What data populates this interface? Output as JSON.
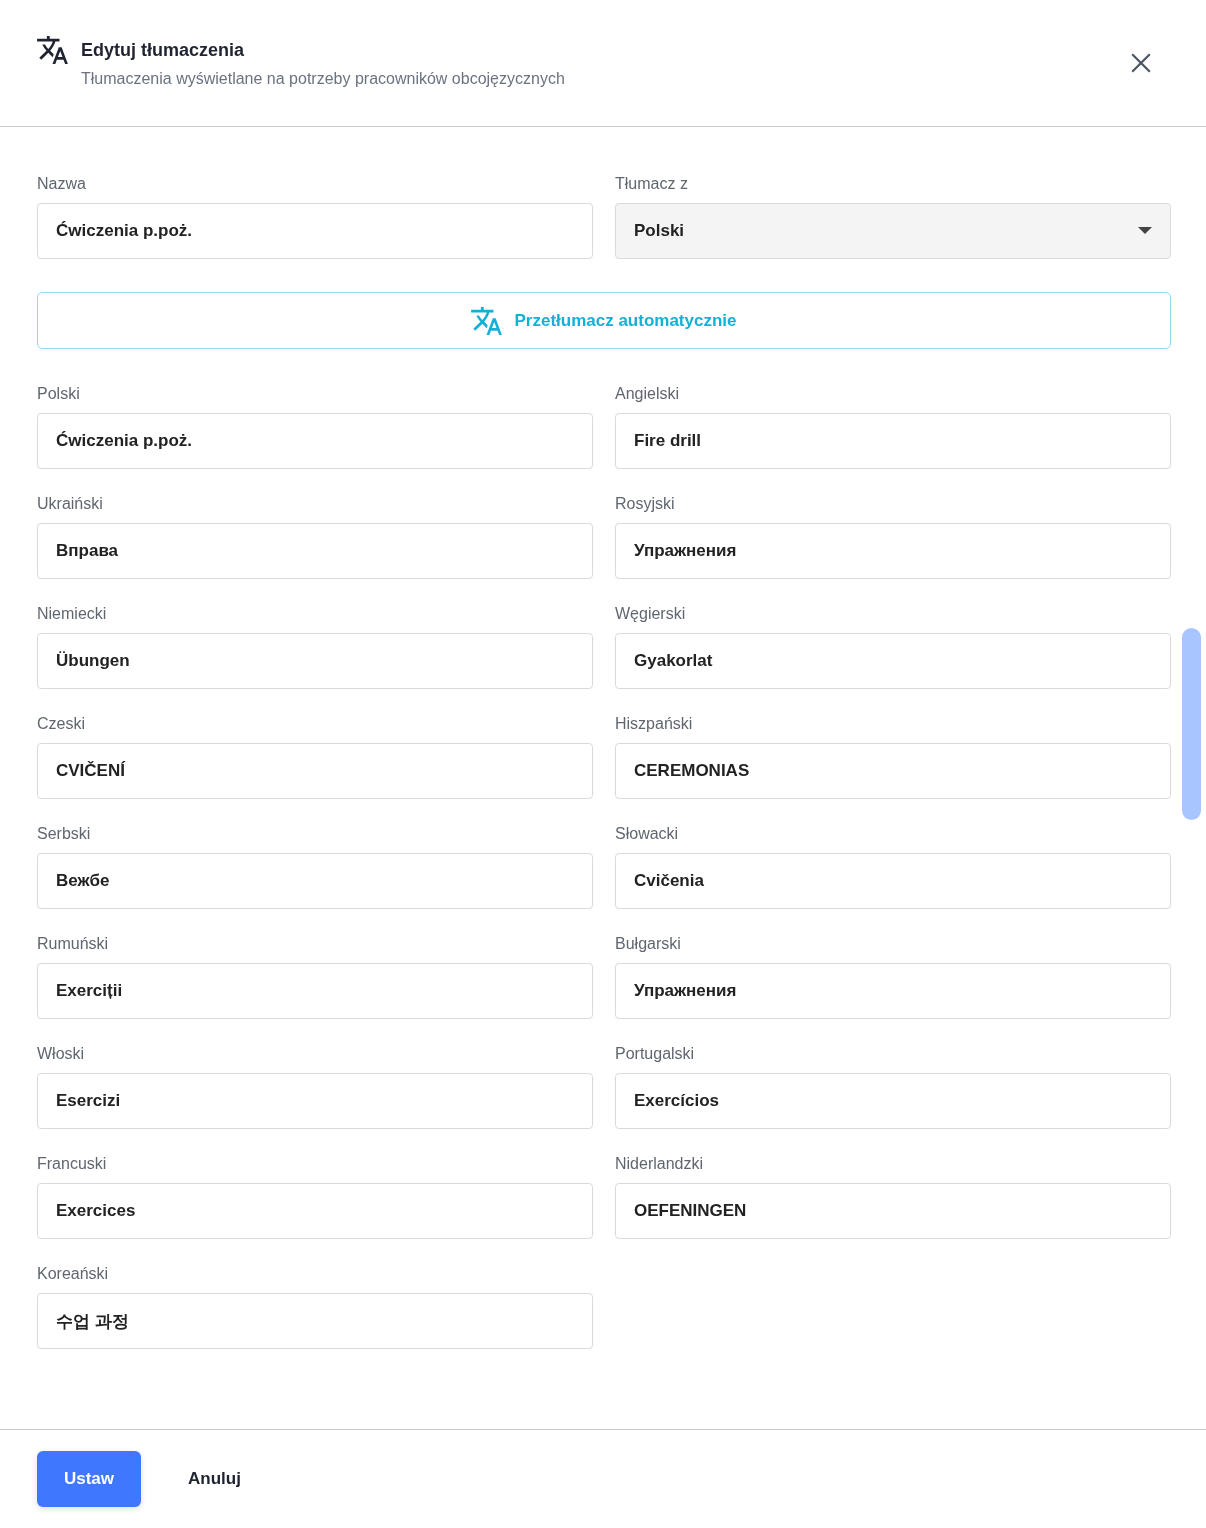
{
  "dialog": {
    "title": "Edytuj tłumaczenia",
    "subtitle": "Tłumaczenia wyświetlane na potrzeby pracowników obcojęzycznych"
  },
  "name_field": {
    "label": "Nazwa",
    "value": "Ćwiczenia p.poż."
  },
  "source_language": {
    "label": "Tłumacz z",
    "value": "Polski"
  },
  "auto_translate_button": "Przetłumacz automatycznie",
  "translations": [
    {
      "label": "Polski",
      "value": "Ćwiczenia p.poż."
    },
    {
      "label": "Angielski",
      "value": "Fire drill"
    },
    {
      "label": "Ukraiński",
      "value": "Вправа"
    },
    {
      "label": "Rosyjski",
      "value": "Упражнения"
    },
    {
      "label": "Niemiecki",
      "value": "Übungen"
    },
    {
      "label": "Węgierski",
      "value": "Gyakorlat"
    },
    {
      "label": "Czeski",
      "value": "CVIČENÍ"
    },
    {
      "label": "Hiszpański",
      "value": "CEREMONIAS"
    },
    {
      "label": "Serbski",
      "value": "Вежбе"
    },
    {
      "label": "Słowacki",
      "value": "Cvičenia"
    },
    {
      "label": "Rumuński",
      "value": "Exerciții"
    },
    {
      "label": "Bułgarski",
      "value": "Упражнения"
    },
    {
      "label": "Włoski",
      "value": "Esercizi"
    },
    {
      "label": "Portugalski",
      "value": "Exercícios"
    },
    {
      "label": "Francuski",
      "value": "Exercices"
    },
    {
      "label": "Niderlandzki",
      "value": "OEFENINGEN"
    },
    {
      "label": "Koreański",
      "value": "수업 과정"
    }
  ],
  "footer_buttons": [
    {
      "label": "Ustaw",
      "kind": "primary"
    },
    {
      "label": "Anuluj",
      "kind": "plain"
    }
  ]
}
